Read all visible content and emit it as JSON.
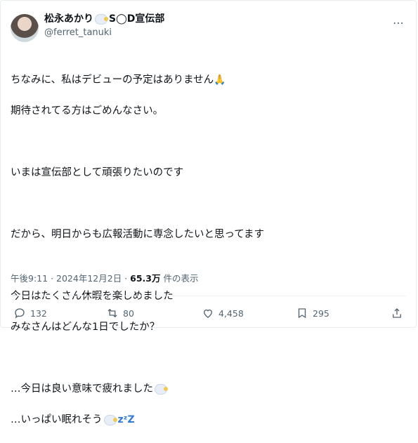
{
  "user": {
    "display_name": "松永あかり",
    "display_suffix": "S◯D宣伝部",
    "handle": "@ferret_tanuki"
  },
  "tweet": {
    "lines": [
      "ちなみに、私はデビューの予定はありません",
      "期待されてる方はごめんなさい。",
      "",
      "いまは宣伝部として頑張りたいのです",
      "",
      "だから、明日からも広報活動に専念したいと思ってます",
      "",
      "今日はたくさん休暇を楽しめました",
      "みなさんはどんな1日でしたか？",
      "",
      "…今日は良い意味で疲れました",
      "…いっぱい眠れそう"
    ]
  },
  "meta": {
    "time": "午後9:11",
    "separator": "·",
    "date": "2024年12月2日",
    "views_count": "65.3万",
    "views_label": "件の表示"
  },
  "actions": {
    "replies": "132",
    "retweets": "80",
    "likes": "4,458",
    "bookmarks": "295"
  },
  "icons": {
    "more": "more-icon",
    "reply": "reply-icon",
    "retweet": "retweet-icon",
    "like": "heart-icon",
    "bookmark": "bookmark-icon",
    "share": "share-icon"
  }
}
